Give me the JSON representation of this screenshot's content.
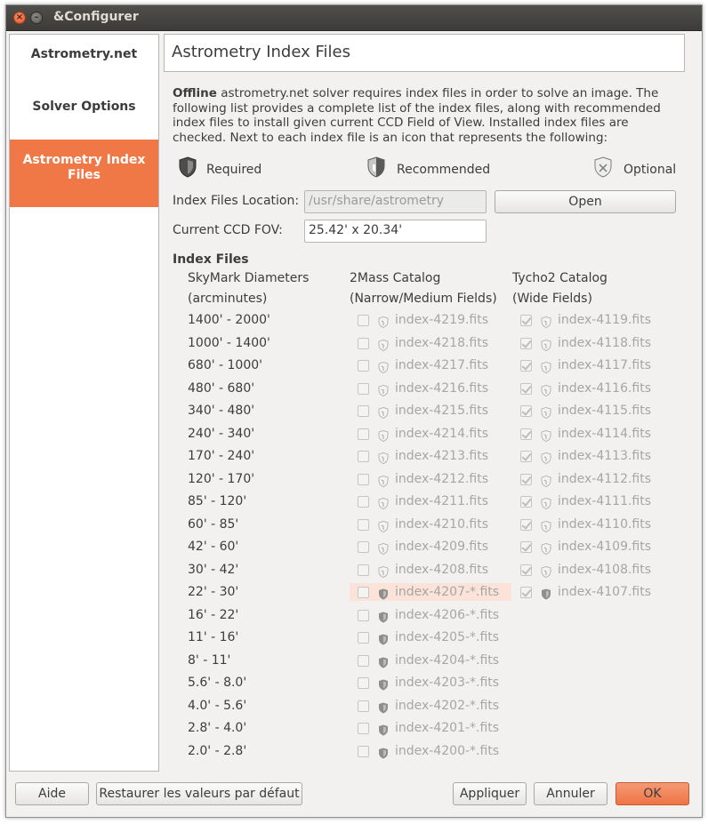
{
  "window": {
    "title": "&Configurer",
    "close_glyph": "×",
    "minimize_glyph": "–"
  },
  "sidebar": {
    "items": [
      {
        "label": "Astrometry.net",
        "active": false
      },
      {
        "label": "Solver Options",
        "active": false
      },
      {
        "label": "Astrometry Index Files",
        "active": true
      }
    ]
  },
  "header": {
    "title": "Astrometry Index Files"
  },
  "description": {
    "bold_lead": "Offline",
    "text": " astrometry.net solver requires index files in order to solve an image. The following list provides a complete list of the index files, along with recommended index files to install given current CCD Field of View. Installed index files are checked. Next to each index file is an icon that represents the following:"
  },
  "legend": {
    "required": "Required",
    "recommended": "Recommended",
    "optional": "Optional"
  },
  "location": {
    "label": "Index Files Location:",
    "value": "/usr/share/astrometry",
    "open_button": "Open"
  },
  "fov": {
    "label": "Current CCD FOV:",
    "value": "25.42' x 20.34'"
  },
  "index_files": {
    "section_label": "Index Files",
    "col_diam_1": "SkyMark Diameters",
    "col_diam_2": "(arcminutes)",
    "col_2mass_1": "2Mass Catalog",
    "col_2mass_2": "(Narrow/Medium Fields)",
    "col_tycho_1": "Tycho2 Catalog",
    "col_tycho_2": "(Wide Fields)",
    "rows": [
      {
        "diam": "1400' - 2000'",
        "mass": "index-4219.fits",
        "tycho": "index-4119.fits"
      },
      {
        "diam": "1000' - 1400'",
        "mass": "index-4218.fits",
        "tycho": "index-4118.fits"
      },
      {
        "diam": "680' - 1000'",
        "mass": "index-4217.fits",
        "tycho": "index-4117.fits"
      },
      {
        "diam": "480' - 680'",
        "mass": "index-4216.fits",
        "tycho": "index-4116.fits"
      },
      {
        "diam": "340' - 480'",
        "mass": "index-4215.fits",
        "tycho": "index-4115.fits"
      },
      {
        "diam": "240' - 340'",
        "mass": "index-4214.fits",
        "tycho": "index-4114.fits"
      },
      {
        "diam": "170' - 240'",
        "mass": "index-4213.fits",
        "tycho": "index-4113.fits"
      },
      {
        "diam": "120' - 170'",
        "mass": "index-4212.fits",
        "tycho": "index-4112.fits"
      },
      {
        "diam": "85' - 120'",
        "mass": "index-4211.fits",
        "tycho": "index-4111.fits"
      },
      {
        "diam": "60' - 85'",
        "mass": "index-4210.fits",
        "tycho": "index-4110.fits"
      },
      {
        "diam": "42' - 60'",
        "mass": "index-4209.fits",
        "tycho": "index-4109.fits"
      },
      {
        "diam": "30' - 42'",
        "mass": "index-4208.fits",
        "tycho": "index-4108.fits"
      },
      {
        "diam": "22' - 30'",
        "mass": "index-4207-*.fits",
        "tycho": "index-4107.fits"
      },
      {
        "diam": "16' - 22'",
        "mass": "index-4206-*.fits",
        "tycho": ""
      },
      {
        "diam": "11' - 16'",
        "mass": "index-4205-*.fits",
        "tycho": ""
      },
      {
        "diam": "8' - 11'",
        "mass": "index-4204-*.fits",
        "tycho": ""
      },
      {
        "diam": "5.6' - 8.0'",
        "mass": "index-4203-*.fits",
        "tycho": ""
      },
      {
        "diam": "4.0' - 5.6'",
        "mass": "index-4202-*.fits",
        "tycho": ""
      },
      {
        "diam": "2.8' - 4.0'",
        "mass": "index-4201-*.fits",
        "tycho": ""
      },
      {
        "diam": "2.0' - 2.8'",
        "mass": "index-4200-*.fits",
        "tycho": ""
      }
    ]
  },
  "buttons": {
    "help": "Aide",
    "restore": "Restaurer les valeurs par défaut",
    "apply": "Appliquer",
    "cancel": "Annuler",
    "ok": "OK"
  }
}
